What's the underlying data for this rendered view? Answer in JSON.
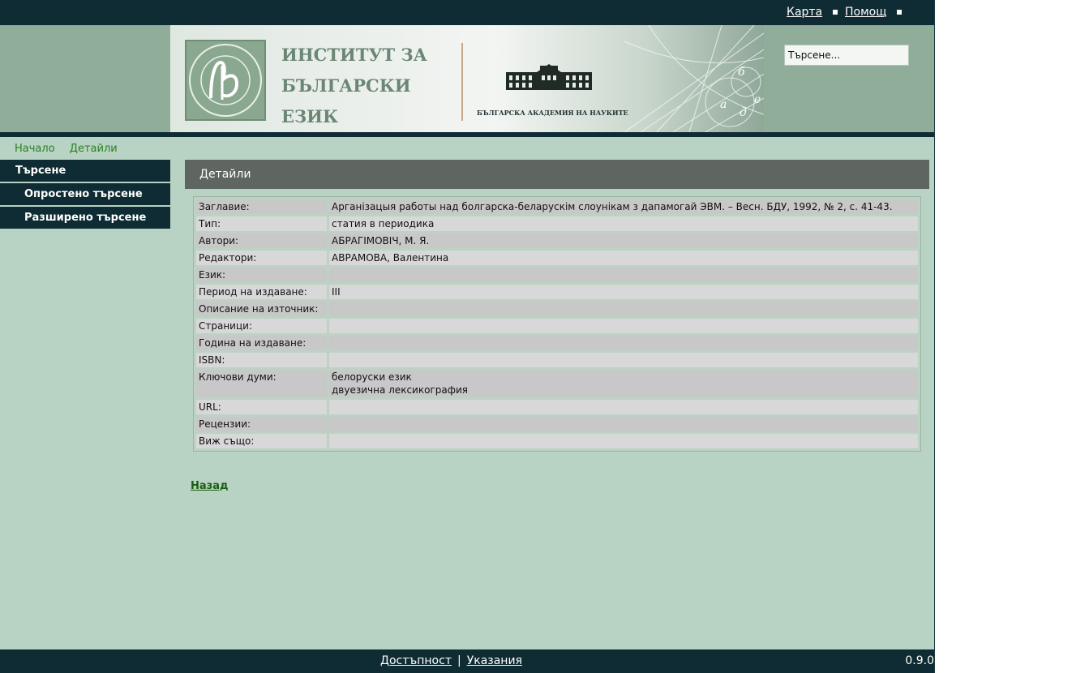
{
  "topbar": {
    "map_label": "Карта",
    "help_label": "Помощ"
  },
  "banner": {
    "title_lines": [
      "ИНСТИТУТ ЗА",
      "БЪЛГАРСКИ",
      "ЕЗИК"
    ],
    "seal_text": "ИНСТИТУТ ЗА БЪЛГАРСКИ ЕЗИК",
    "academy": "БЪЛГАРСКА АКАДЕМИЯ НА НАУКИТЕ"
  },
  "search": {
    "placeholder": "Търсене...",
    "value": "Търсене..."
  },
  "breadcrumb": [
    "Начало",
    "Детайли"
  ],
  "sidebar": {
    "header": "Търсене",
    "items": [
      {
        "label": "Опростено търсене"
      },
      {
        "label": "Разширено търсене"
      }
    ]
  },
  "main": {
    "title": "Детайли",
    "back_label": "Назад"
  },
  "details": [
    {
      "label": "Заглавие:",
      "value": "Арганізацыя работы над болгарска-беларускім слоунікам з дапамогай ЭВМ. – Весн. БДУ, 1992, № 2, с. 41-43."
    },
    {
      "label": "Тип:",
      "value": "статия в периодика"
    },
    {
      "label": "Автори:",
      "value": "АБРАГІМОВІЧ, М. Я."
    },
    {
      "label": "Редактори:",
      "value": "АВРАМОВА, Валентина"
    },
    {
      "label": "Език:",
      "value": ""
    },
    {
      "label": "Период на издаване:",
      "value": "III"
    },
    {
      "label": "Описание на източник:",
      "value": ""
    },
    {
      "label": "Страници:",
      "value": ""
    },
    {
      "label": "Година на издаване:",
      "value": ""
    },
    {
      "label": "ISBN:",
      "value": ""
    },
    {
      "label": "Ключови думи:",
      "value": "белоруски език\nдвуезична лексикография"
    },
    {
      "label": "URL:",
      "value": ""
    },
    {
      "label": "Рецензии:",
      "value": ""
    },
    {
      "label": "Виж също:",
      "value": ""
    }
  ],
  "footer": {
    "accessibility": "Достъпност",
    "separator": "|",
    "guidelines": "Указания",
    "version": "0.9.0"
  },
  "colors": {
    "dark": "#0f2b33",
    "page_bg": "#b8d3c3",
    "header_bg": "#8fad98",
    "link_green": "#2a7f22"
  }
}
